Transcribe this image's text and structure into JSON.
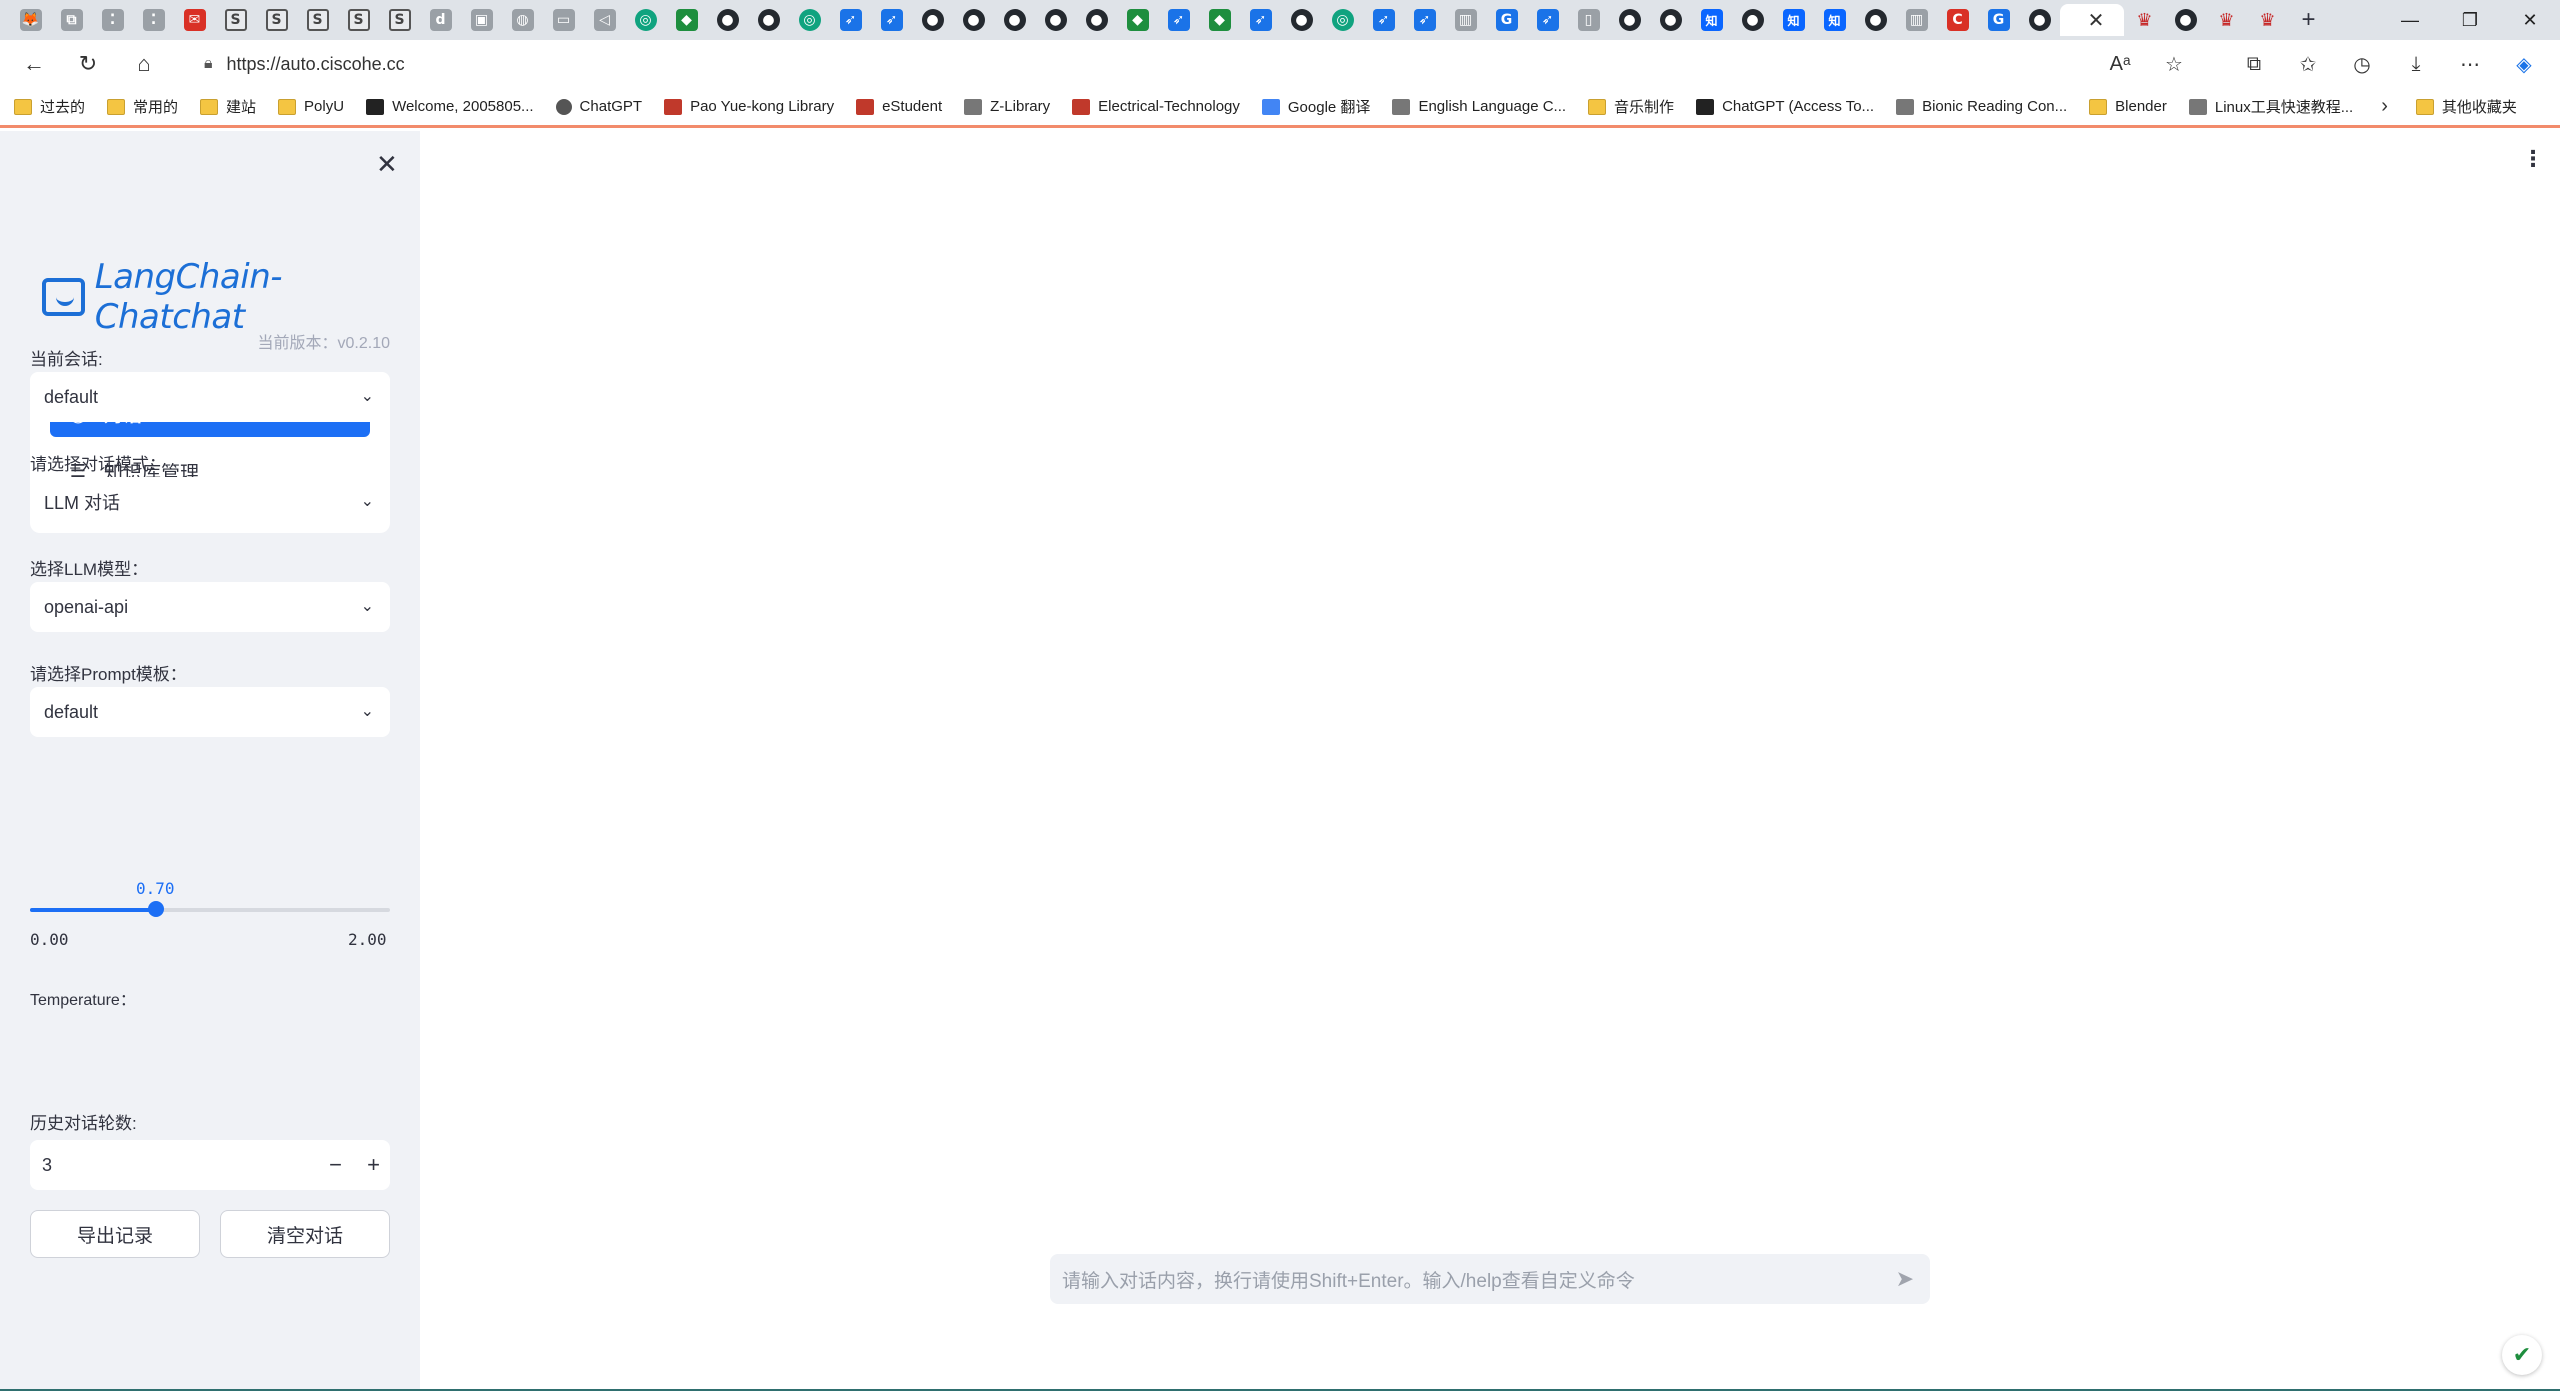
{
  "browser": {
    "tabs": [
      {
        "icon": "gh-avatar-icon",
        "glyph": "🦊"
      },
      {
        "icon": "collections-icon",
        "glyph": "⧉"
      },
      {
        "icon": "dots-icon",
        "glyph": "⁚"
      },
      {
        "icon": "dots-icon",
        "glyph": "⁚"
      },
      {
        "icon": "mail-icon",
        "glyph": "✉"
      },
      {
        "icon": "s-icon",
        "glyph": "S"
      },
      {
        "icon": "s-icon",
        "glyph": "S"
      },
      {
        "icon": "s-icon",
        "glyph": "S"
      },
      {
        "icon": "s-icon",
        "glyph": "S"
      },
      {
        "icon": "s-icon",
        "glyph": "S"
      },
      {
        "icon": "d-icon",
        "glyph": "d"
      },
      {
        "icon": "page-icon",
        "glyph": "▣"
      },
      {
        "icon": "globe-icon",
        "glyph": "◍"
      },
      {
        "icon": "tv-icon",
        "glyph": "▭"
      },
      {
        "icon": "speaker-icon",
        "glyph": "◁"
      },
      {
        "icon": "openai-icon",
        "glyph": "◎"
      },
      {
        "icon": "shield-icon",
        "glyph": "◆"
      },
      {
        "icon": "cat-icon",
        "glyph": "●"
      },
      {
        "icon": "cat-icon",
        "glyph": "●"
      },
      {
        "icon": "openai-icon",
        "glyph": "◎"
      },
      {
        "icon": "bird-icon",
        "glyph": "➶"
      },
      {
        "icon": "bird-icon",
        "glyph": "➶"
      },
      {
        "icon": "github-icon",
        "glyph": "●"
      },
      {
        "icon": "github-icon",
        "glyph": "●"
      },
      {
        "icon": "github-icon",
        "glyph": "●"
      },
      {
        "icon": "github-icon",
        "glyph": "●"
      },
      {
        "icon": "github-icon",
        "glyph": "●"
      },
      {
        "icon": "shield-icon",
        "glyph": "◆"
      },
      {
        "icon": "bird-icon",
        "glyph": "➶"
      },
      {
        "icon": "shield-icon",
        "glyph": "◆"
      },
      {
        "icon": "bird-icon",
        "glyph": "➶"
      },
      {
        "icon": "record-icon",
        "glyph": "●"
      },
      {
        "icon": "openai-icon",
        "glyph": "◎"
      },
      {
        "icon": "bird-icon",
        "glyph": "➶"
      },
      {
        "icon": "bird-icon",
        "glyph": "➶"
      },
      {
        "icon": "book-icon",
        "glyph": "▥"
      },
      {
        "icon": "google-icon",
        "glyph": "G"
      },
      {
        "icon": "bird-icon",
        "glyph": "➶"
      },
      {
        "icon": "file-icon",
        "glyph": "▯"
      },
      {
        "icon": "github-icon",
        "glyph": "●"
      },
      {
        "icon": "github-icon",
        "glyph": "●"
      },
      {
        "icon": "zhihu-icon",
        "glyph": "知"
      },
      {
        "icon": "github-icon",
        "glyph": "●"
      },
      {
        "icon": "zhihu-icon",
        "glyph": "知"
      },
      {
        "icon": "zhihu-icon",
        "glyph": "知"
      },
      {
        "icon": "github-icon",
        "glyph": "●"
      },
      {
        "icon": "book-icon",
        "glyph": "▥"
      },
      {
        "icon": "c-icon",
        "glyph": "C"
      },
      {
        "icon": "google-icon",
        "glyph": "G"
      },
      {
        "icon": "github-icon",
        "glyph": "●"
      }
    ],
    "active_tab_close": "✕",
    "after_tabs": [
      {
        "icon": "crown-icon",
        "glyph": "♛"
      },
      {
        "icon": "github-icon",
        "glyph": "●"
      },
      {
        "icon": "crown-icon",
        "glyph": "♛"
      },
      {
        "icon": "crown-icon",
        "glyph": "♛"
      }
    ],
    "new_tab": "+",
    "url": "https://auto.ciscohe.cc",
    "bookmarks": [
      {
        "label": "过去的",
        "icon": "folder"
      },
      {
        "label": "常用的",
        "icon": "folder"
      },
      {
        "label": "建站",
        "icon": "folder"
      },
      {
        "label": "PolyU",
        "icon": "folder"
      },
      {
        "label": "Welcome, 2005805...",
        "icon": "dark"
      },
      {
        "label": "ChatGPT",
        "icon": "dot"
      },
      {
        "label": "Pao Yue-kong Library",
        "icon": "red"
      },
      {
        "label": "eStudent",
        "icon": "red"
      },
      {
        "label": "Z-Library",
        "icon": "gray"
      },
      {
        "label": "Electrical-Technology",
        "icon": "red"
      },
      {
        "label": "Google 翻译",
        "icon": "blue"
      },
      {
        "label": "English Language C...",
        "icon": "gray"
      },
      {
        "label": "音乐制作",
        "icon": "folder"
      },
      {
        "label": "ChatGPT (Access To...",
        "icon": "dark"
      },
      {
        "label": "Bionic Reading Con...",
        "icon": "gray"
      },
      {
        "label": "Blender",
        "icon": "folder"
      },
      {
        "label": "Linux工具快速教程...",
        "icon": "gray"
      }
    ],
    "other_bookmarks": "其他收藏夹"
  },
  "sidebar": {
    "logo_text": "LangChain-Chatchat",
    "version": "当前版本：v0.2.10",
    "menu": [
      {
        "label": "对话",
        "icon": "chat-icon"
      },
      {
        "label": "知识库管理",
        "icon": "database-icon"
      }
    ],
    "conversation_label": "当前会话:",
    "conversation_value": "default",
    "mode_label": "请选择对话模式：",
    "mode_value": "LLM 对话",
    "model_label": "选择LLM模型：",
    "model_value": "openai-api",
    "prompt_label": "请选择Prompt模板：",
    "prompt_value": "default",
    "temperature_label": "Temperature：",
    "temperature": {
      "value": "0.70",
      "min": "0.00",
      "max": "2.00",
      "fraction": 0.35
    },
    "history_label": "历史对话轮数:",
    "history_value": "3",
    "export_button": "导出记录",
    "clear_button": "清空对话"
  },
  "main": {
    "chat_placeholder": "请输入对话内容，换行请使用Shift+Enter。输入/help查看自定义命令"
  },
  "colors": {
    "accent": "#1c6ff5",
    "sidebar_bg": "#f0f2f6"
  }
}
